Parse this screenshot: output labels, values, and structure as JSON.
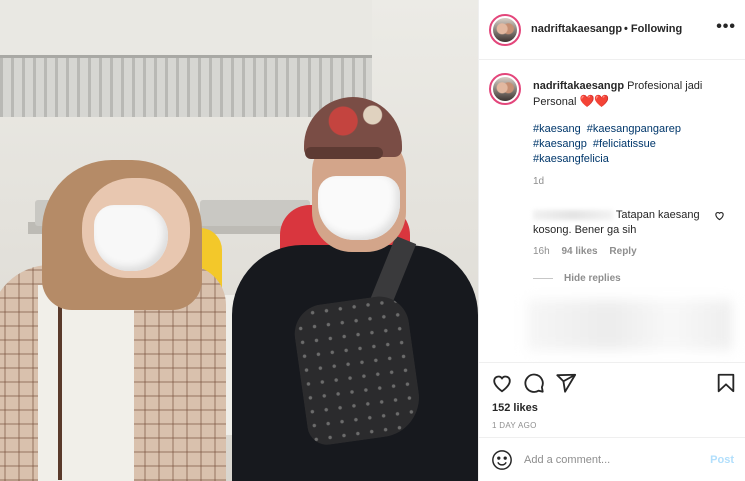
{
  "post": {
    "username": "nadriftakaesangp",
    "follow_status": "• Following",
    "more_icon": "more-horizontal-icon"
  },
  "caption": {
    "username": "nadriftakaesangp",
    "text": "Profesional jadi Personal",
    "hearts": "❤️❤️",
    "hashtags": [
      "#kaesang",
      "#kaesangpangarep",
      "#kaesangp",
      "#feliciatissue",
      "#kaesangfelicia"
    ],
    "time": "1d"
  },
  "comment": {
    "text": "Tatapan kaesang kosong. Bener ga sih",
    "time": "16h",
    "likes": "94 likes",
    "reply_label": "Reply",
    "hide_replies_label": "Hide replies"
  },
  "actions": {
    "icons": [
      "heart-icon",
      "comment-icon",
      "share-icon",
      "bookmark-icon"
    ],
    "likes_count": "152 likes",
    "posted_ago": "1 DAY AGO"
  },
  "composer": {
    "placeholder": "Add a comment...",
    "post_label": "Post"
  },
  "colors": {
    "link": "#00376b",
    "muted": "#8e8e8e",
    "post_disabled": "#b2dffc",
    "story_ring": "#e3467b"
  }
}
